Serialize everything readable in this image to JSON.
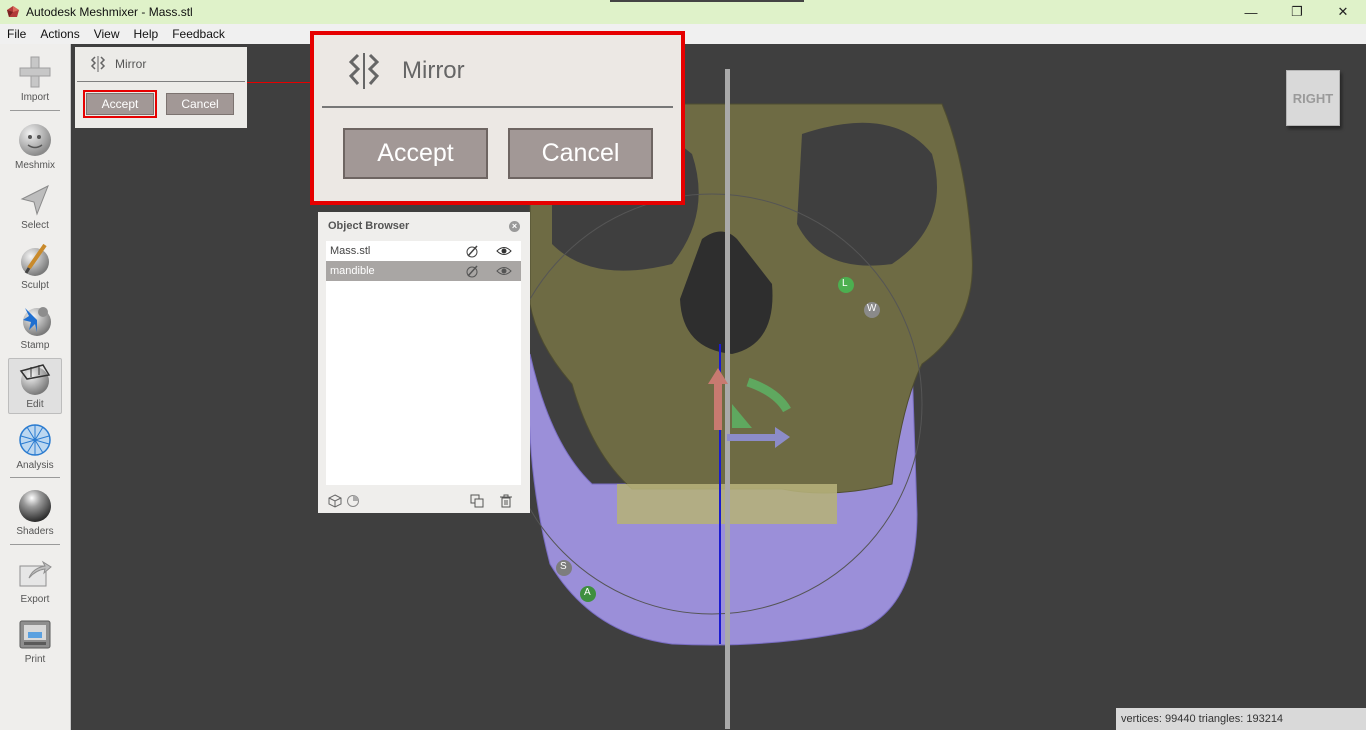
{
  "window": {
    "title": "Autodesk Meshmixer - Mass.stl",
    "controls": {
      "minimize": "—",
      "restore": "❐",
      "close": "✕"
    }
  },
  "menu": [
    "File",
    "Actions",
    "View",
    "Help",
    "Feedback"
  ],
  "toolbar": {
    "items": [
      {
        "label": "Import",
        "icon": "plus-icon"
      },
      {
        "label": "Meshmix",
        "icon": "meshmix-ball-icon"
      },
      {
        "label": "Select",
        "icon": "select-arrow-icon"
      },
      {
        "label": "Sculpt",
        "icon": "sculpt-brush-icon"
      },
      {
        "label": "Stamp",
        "icon": "stamp-icon"
      },
      {
        "label": "Edit",
        "icon": "edit-sphere-icon",
        "active": true
      },
      {
        "label": "Analysis",
        "icon": "analysis-mesh-icon"
      },
      {
        "label": "Shaders",
        "icon": "shaders-ball-icon"
      },
      {
        "label": "Export",
        "icon": "export-icon"
      },
      {
        "label": "Print",
        "icon": "print-icon"
      }
    ]
  },
  "mirror_panel": {
    "title": "Mirror",
    "accept_label": "Accept",
    "cancel_label": "Cancel"
  },
  "mirror_zoom": {
    "title": "Mirror",
    "accept_label": "Accept",
    "cancel_label": "Cancel"
  },
  "object_browser": {
    "title": "Object Browser",
    "close_glyph": "×",
    "objects": [
      {
        "name": "Mass.stl",
        "selected": false
      },
      {
        "name": "mandible",
        "selected": true
      }
    ]
  },
  "viewcube": {
    "label": "RIGHT"
  },
  "gizmo_labels": {
    "l": "L",
    "w": "W",
    "s": "S",
    "a": "A"
  },
  "status": {
    "text": "vertices: 99440 triangles: 193214"
  },
  "colors": {
    "titlebar": "#dff2c9",
    "highlight": "#e60000",
    "skull": "#6e6b44",
    "mandible": "#9b8fd9",
    "button": "#a29896"
  }
}
